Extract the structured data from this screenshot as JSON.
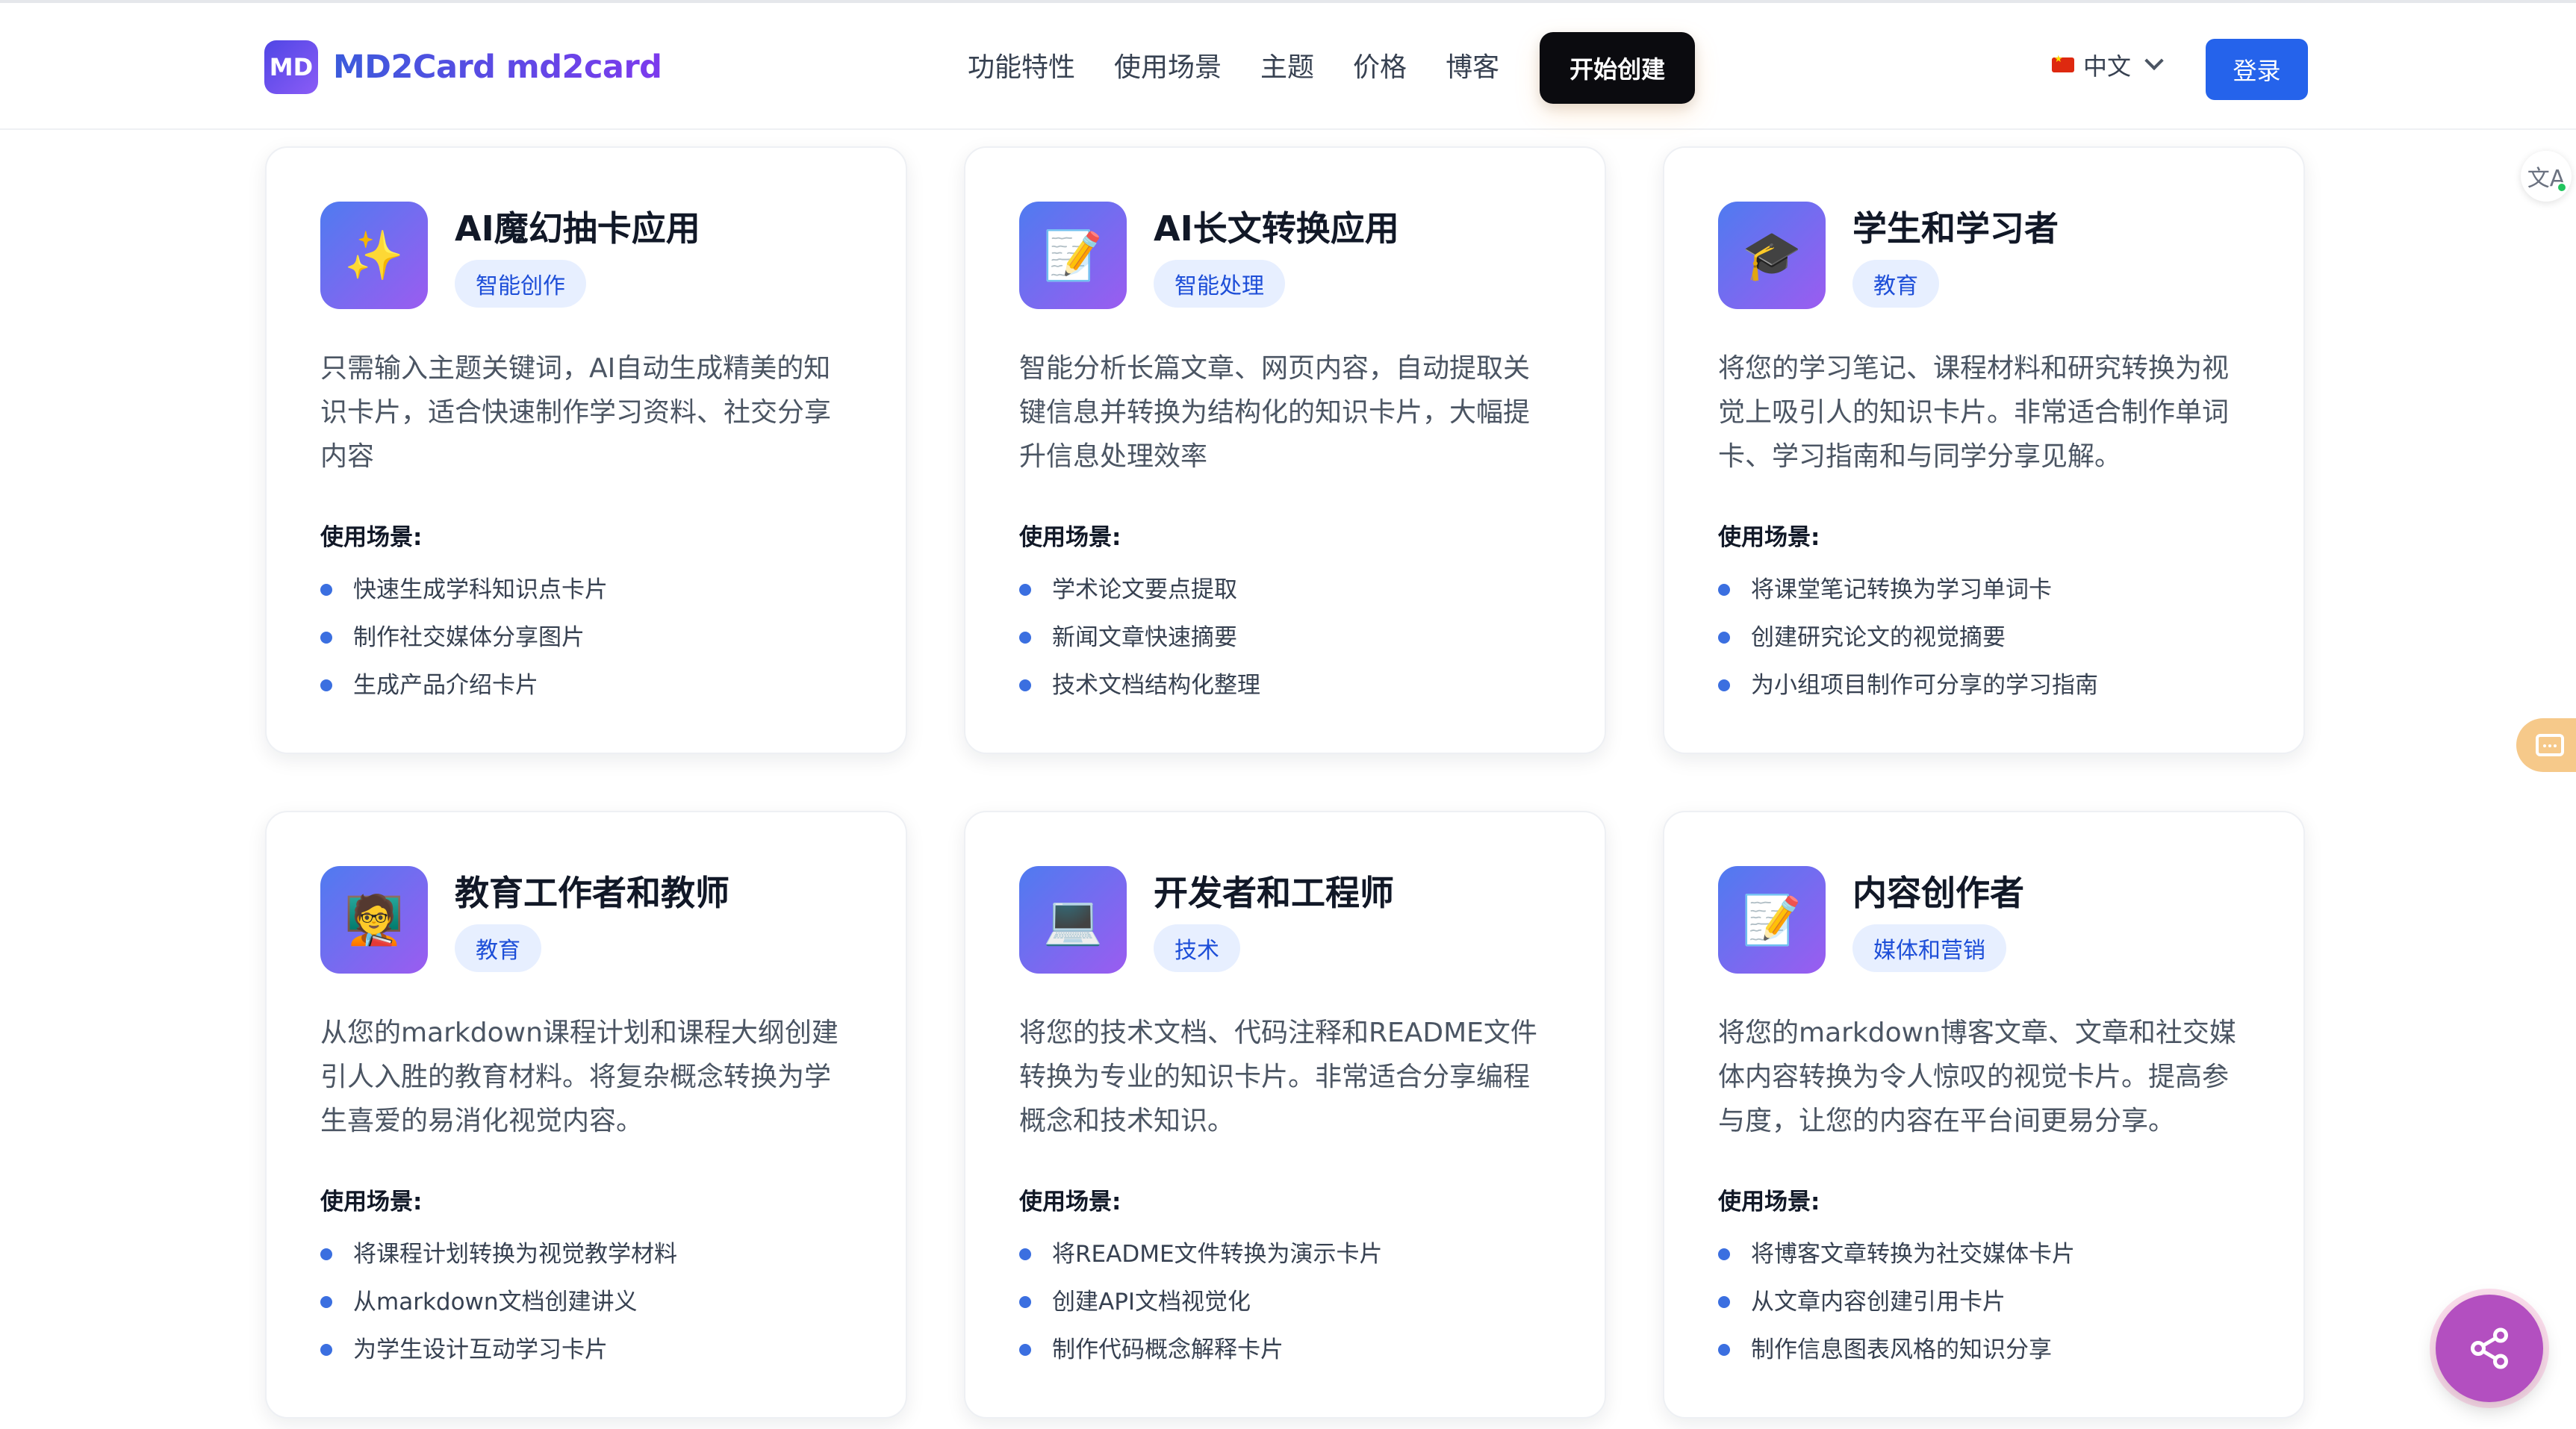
{
  "header": {
    "logo_badge": "MD",
    "brand_name": "MD2Card md2card",
    "nav": [
      "功能特性",
      "使用场景",
      "主题",
      "价格",
      "博客"
    ],
    "cta_label": "开始创建",
    "language": "中文",
    "login_label": "登录"
  },
  "uses_label": "使用场景:",
  "cards": [
    {
      "icon": "sparkles-icon",
      "emoji": "✨",
      "title": "AI魔幻抽卡应用",
      "tag": "智能创作",
      "desc": "只需输入主题关键词，AI自动生成精美的知识卡片，适合快速制作学习资料、社交分享内容",
      "uses": [
        "快速生成学科知识点卡片",
        "制作社交媒体分享图片",
        "生成产品介绍卡片"
      ]
    },
    {
      "icon": "memo-icon",
      "emoji": "📝",
      "title": "AI长文转换应用",
      "tag": "智能处理",
      "desc": "智能分析长篇文章、网页内容，自动提取关键信息并转换为结构化的知识卡片，大幅提升信息处理效率",
      "uses": [
        "学术论文要点提取",
        "新闻文章快速摘要",
        "技术文档结构化整理"
      ]
    },
    {
      "icon": "graduation-cap-icon",
      "emoji": "🎓",
      "title": "学生和学习者",
      "tag": "教育",
      "desc": "将您的学习笔记、课程材料和研究转换为视觉上吸引人的知识卡片。非常适合制作单词卡、学习指南和与同学分享见解。",
      "uses": [
        "将课堂笔记转换为学习单词卡",
        "创建研究论文的视觉摘要",
        "为小组项目制作可分享的学习指南"
      ]
    },
    {
      "icon": "teacher-icon",
      "emoji": "🧑‍🏫",
      "title": "教育工作者和教师",
      "tag": "教育",
      "desc": "从您的markdown课程计划和课程大纲创建引人入胜的教育材料。将复杂概念转换为学生喜爱的易消化视觉内容。",
      "uses": [
        "将课程计划转换为视觉教学材料",
        "从markdown文档创建讲义",
        "为学生设计互动学习卡片"
      ]
    },
    {
      "icon": "laptop-icon",
      "emoji": "💻",
      "title": "开发者和工程师",
      "tag": "技术",
      "desc": "将您的技术文档、代码注释和README文件转换为专业的知识卡片。非常适合分享编程概念和技术知识。",
      "uses": [
        "将README文件转换为演示卡片",
        "创建API文档视觉化",
        "制作代码概念解释卡片"
      ]
    },
    {
      "icon": "memo-icon",
      "emoji": "📝",
      "title": "内容创作者",
      "tag": "媒体和营销",
      "desc": "将您的markdown博客文章、文章和社交媒体内容转换为令人惊叹的视觉卡片。提高参与度，让您的内容在平台间更易分享。",
      "uses": [
        "将博客文章转换为社交媒体卡片",
        "从文章内容创建引用卡片",
        "制作信息图表风格的知识分享"
      ]
    }
  ],
  "widgets": {
    "translate_glyph": "文A"
  }
}
